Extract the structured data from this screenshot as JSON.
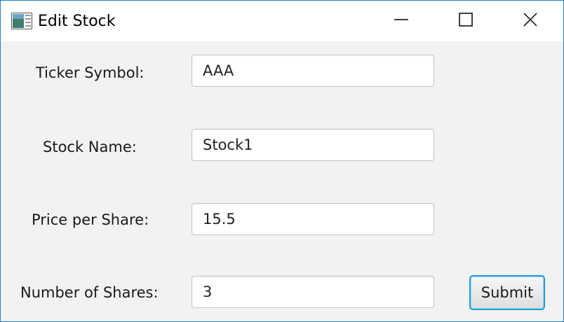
{
  "window": {
    "title": "Edit Stock",
    "icons": {
      "app": "stock-app-icon",
      "minimize": "minimize-icon",
      "maximize": "maximize-icon",
      "close": "close-icon"
    },
    "colors": {
      "border": "#1883d7",
      "titlebar": "#ffffff",
      "content_bg": "#f2f2f2",
      "accent": "#1f9ed9"
    }
  },
  "form": {
    "ticker": {
      "label": "Ticker Symbol:",
      "value": "AAA"
    },
    "name": {
      "label": "Stock Name:",
      "value": "Stock1"
    },
    "price": {
      "label": "Price per Share:",
      "value": "15.5"
    },
    "shares": {
      "label": "Number of Shares:",
      "value": "3"
    },
    "submit_label": "Submit"
  }
}
